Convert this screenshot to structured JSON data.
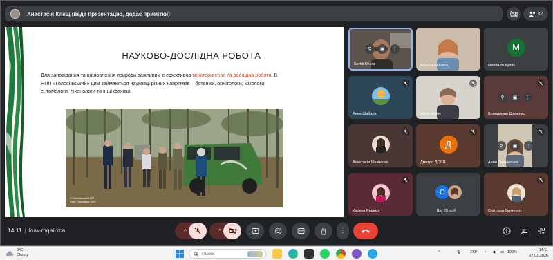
{
  "presenter": {
    "title": "Анастасія Клещ (веде презентацію, додає примітки)"
  },
  "participants_count": "32",
  "slide": {
    "title": "НАУКОВО-ДОСЛІДНА РОБОТА",
    "para_pre": "Для заповідання та відновлення природи важливим є ефективна ",
    "para_highlight": "моніторингова та дослідна робота",
    "para_post": ". В НПП «Голосіївський» цим займаються науковці різних напрямків – ботаніки, орнітологи, мікологи, ентомологи, ліхенологи та інші фахівці.",
    "photo_credit_line1": "© Голосіївський НПП",
    "photo_credit_line2": "Фото: Голосіївськ НПП"
  },
  "tiles": [
    {
      "name": "Serhii Khara"
    },
    {
      "name": "Анастасія Клещ"
    },
    {
      "name": "Михайло Кулик",
      "letter": "М",
      "letter_color": "#137333"
    },
    {
      "name": "Анна Шабалін"
    },
    {
      "name": "Алла Некос"
    },
    {
      "name": "Володимир Шиленко"
    },
    {
      "name": "Анастасія Шевченко"
    },
    {
      "name": "Дмитро ДОЛЯ",
      "letter": "Д",
      "letter_color": "#e8710a"
    },
    {
      "name": "Анна Литвинська"
    },
    {
      "name": "Карина Редько"
    },
    {
      "name": "Ще 20 осіб",
      "letter": "О",
      "letter_color": "#1a73e8"
    },
    {
      "name": "Світлана Бурченко"
    }
  ],
  "meeting": {
    "time": "14:11",
    "code": "kuw-mqai-xca"
  },
  "taskbar": {
    "temp": "9°C",
    "weather": "Cloudy",
    "search_placeholder": "Поиск",
    "lang": "УКР",
    "battery": "100%",
    "clock_time": "14:11",
    "clock_date": "27.03.2026"
  },
  "colors": {
    "meet_bg": "#202124",
    "tile_bg": "#3c4043",
    "end_call": "#ea4335",
    "slide_highlight": "#d24726"
  }
}
